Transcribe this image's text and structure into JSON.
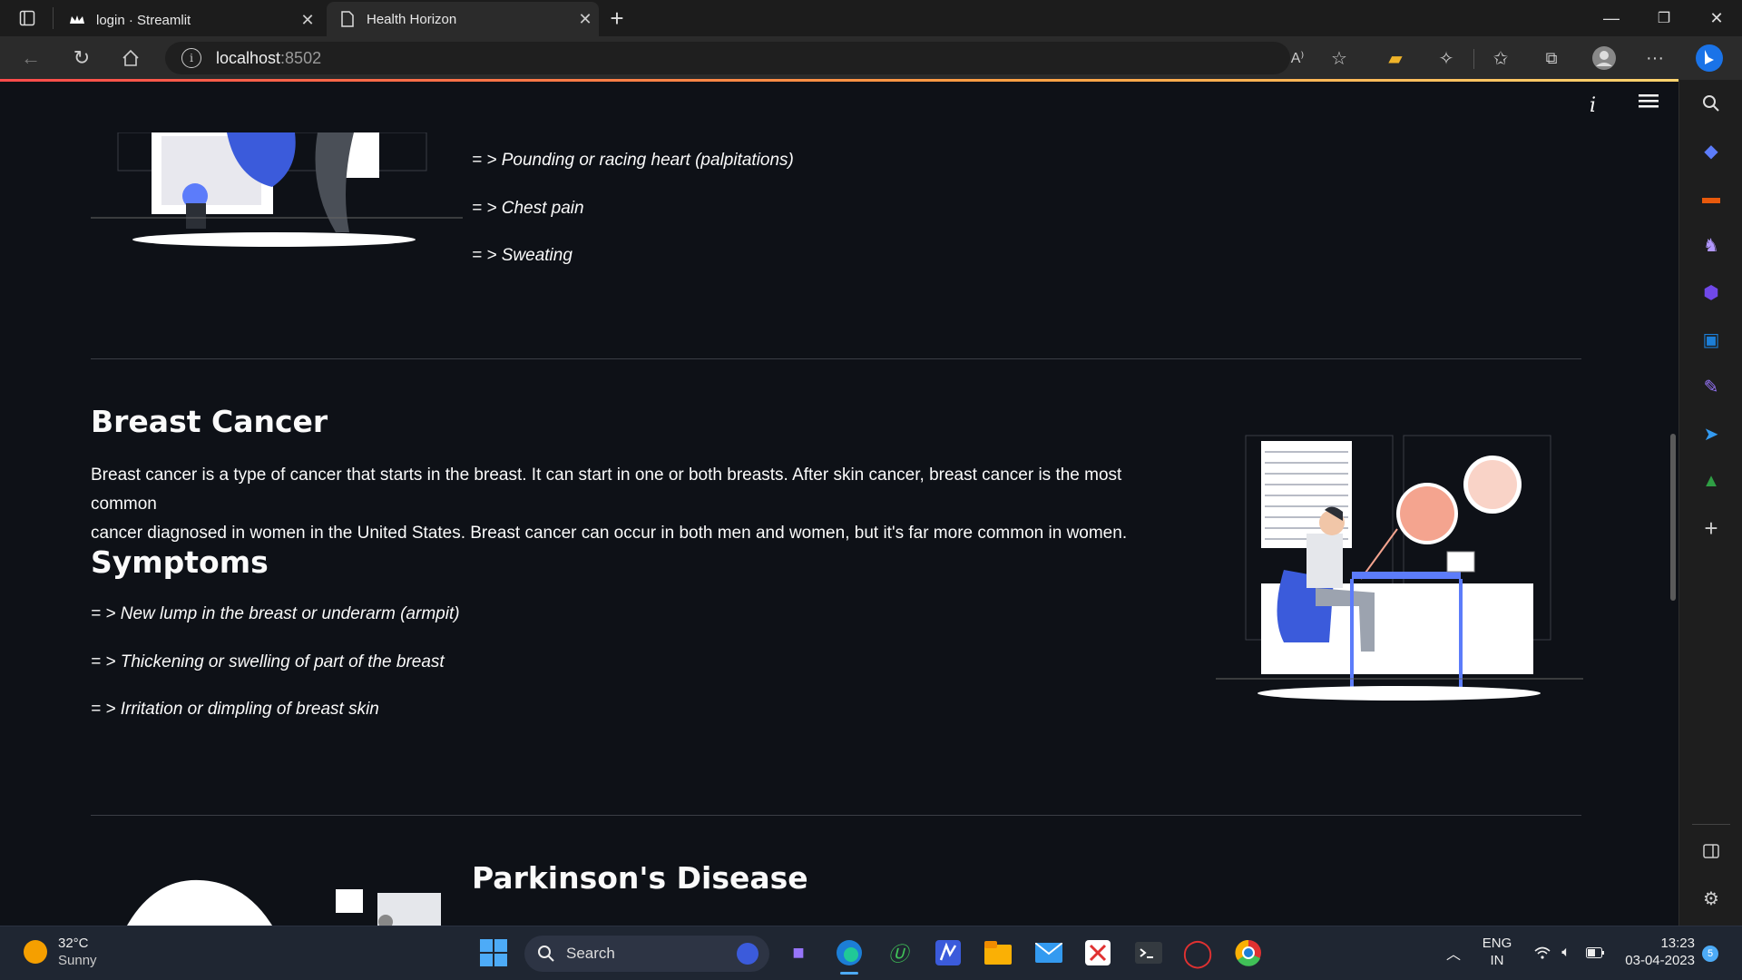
{
  "browser": {
    "tabs": [
      {
        "label": "login · Streamlit"
      },
      {
        "label": "Health Horizon"
      }
    ],
    "url_host": "localhost",
    "url_port": ":8502"
  },
  "main": {
    "heart_symptoms": [
      "= > Pounding or racing heart (palpitations)",
      "= > Chest pain",
      "= > Sweating"
    ],
    "breast": {
      "title": "Breast Cancer",
      "desc_line1": "Breast cancer is a type of cancer that starts in the breast. It can start in one or both breasts. After skin cancer, breast cancer is the most common",
      "desc_line2": "cancer diagnosed in women in the United States. Breast cancer can occur in both men and women, but it's far more common in women.",
      "symptoms_title": "Symptoms",
      "symptoms": [
        "= > New lump in the breast or underarm (armpit)",
        "= > Thickening or swelling of part of the breast",
        "= > Irritation or dimpling of breast skin"
      ]
    },
    "parkinson": {
      "title": "Parkinson's Disease"
    }
  },
  "taskbar": {
    "weather_temp": "32°C",
    "weather_desc": "Sunny",
    "search_label": "Search",
    "lang": "ENG",
    "region": "IN",
    "time": "13:23",
    "date": "03-04-2023",
    "notif_count": "5"
  }
}
